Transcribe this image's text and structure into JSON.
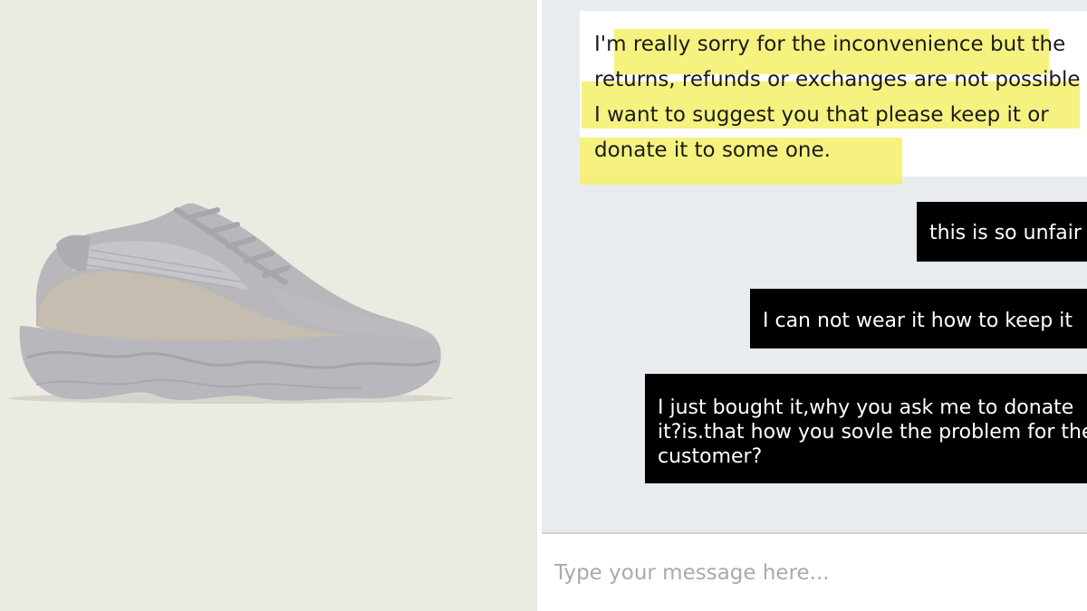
{
  "product": {
    "image_alt": "sneaker",
    "background_color": "#ecebe1",
    "shoe_colors": {
      "upper": "#b9b7bb",
      "mesh": "#c6c5ca",
      "suede": "#c4bdb0",
      "sole": "#b8b7bd"
    }
  },
  "chat": {
    "background_color": "#e9ecef",
    "highlight_color": "#f3f06a",
    "agent_message": {
      "lines": [
        "I'm really sorry for the inconvenience but the",
        "returns, refunds or exchanges  are not possible",
        "I want to suggest you that please keep it or",
        "donate it to some one."
      ]
    },
    "user_messages": [
      {
        "text": "this is so unfair"
      },
      {
        "text": "I can not wear it how to keep it"
      },
      {
        "text": "I just bought it,why you ask me to donate it?is.that how you sovle the problem for the customer?"
      }
    ]
  },
  "composer": {
    "placeholder": "Type your message here..."
  }
}
